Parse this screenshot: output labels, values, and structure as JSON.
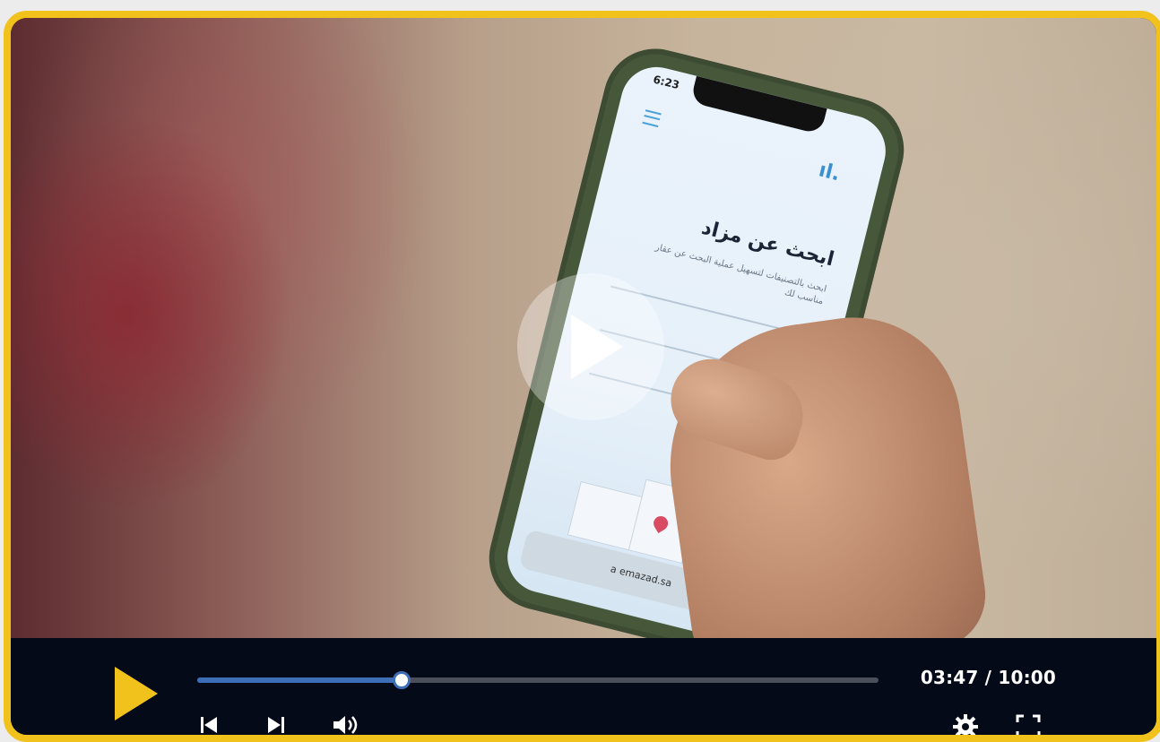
{
  "player": {
    "current_time": "03:47",
    "duration": "10:00",
    "time_display": "03:47 / 10:00",
    "progress_fraction": 0.2994
  },
  "colors": {
    "frame_border": "#f2c21c",
    "play_button": "#f2c21c",
    "progress_fill": "#3d6fb8",
    "control_bar": "#050a18"
  },
  "video_frame": {
    "phone_status_time": "6:23",
    "phone_heading": "ابحث عن مزاد",
    "phone_subtitle": "ابحث بالتصنيفات لتسهيل عملية البحث عن عقار مناسب لك",
    "phone_url": "a emazad.sa"
  },
  "icons": {
    "big_play": "play-icon",
    "play": "play-icon",
    "prev": "skip-back-icon",
    "next": "skip-forward-icon",
    "volume": "volume-icon",
    "settings": "gear-icon",
    "fullscreen": "fullscreen-icon"
  }
}
